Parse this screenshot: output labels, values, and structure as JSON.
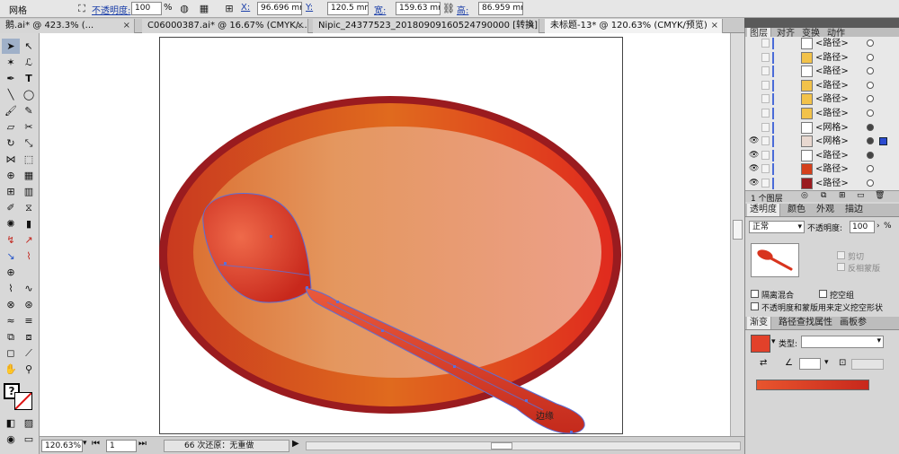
{
  "control_bar": {
    "mode_label": "网格",
    "opacity_label": "不透明度:",
    "opacity_value": "100",
    "percent": "%",
    "x_label": "X:",
    "x_value": "96.696 mm",
    "y_label": "Y:",
    "y_value": "120.5 mm",
    "width_label": "宽:",
    "width_value": "159.63 mm",
    "height_label": "高:",
    "height_value": "86.959 mm"
  },
  "tabs": [
    {
      "label": "鹅.ai* @ 423.3% (..."
    },
    {
      "label": "C06000387.ai* @ 16.67% (CMYK/..."
    },
    {
      "label": "Nipic_24377523_20180909160524790000 [转换].ai*"
    },
    {
      "label": "未标题-13* @ 120.63% (CMYK/预览)"
    }
  ],
  "canvas": {
    "annotation": "边缘",
    "colors": {
      "rim": "#9a1b1f",
      "plate_outer": "#d4401c",
      "plate_inner_left": "#e39a6a",
      "plate_inner_right": "#eda688",
      "spoon": "#e2412a",
      "path": "#5c6fd8"
    }
  },
  "status": {
    "zoom": "120.63%",
    "page": "1",
    "undo": "66 次还原：无重做"
  },
  "layers_panel": {
    "tabs": [
      "图层",
      "对齐",
      "变换",
      "动作"
    ],
    "items": [
      {
        "name": "<路径>",
        "visible": false,
        "thumb": "#ffffff",
        "target": false
      },
      {
        "name": "<路径>",
        "visible": false,
        "thumb": "#f2c24a",
        "target": false
      },
      {
        "name": "<路径>",
        "visible": false,
        "thumb": "#ffffff",
        "target": false
      },
      {
        "name": "<路径>",
        "visible": false,
        "thumb": "#f2c24a",
        "target": false
      },
      {
        "name": "<路径>",
        "visible": false,
        "thumb": "#f2c24a",
        "target": false
      },
      {
        "name": "<路径>",
        "visible": false,
        "thumb": "#f2c24a",
        "target": false
      },
      {
        "name": "<网格>",
        "visible": false,
        "thumb": "#ffffff",
        "target": true
      },
      {
        "name": "<网格>",
        "visible": true,
        "thumb": "#e8d8d0",
        "target": true
      },
      {
        "name": "<路径>",
        "visible": true,
        "thumb": "#ffffff",
        "target": true
      },
      {
        "name": "<路径>",
        "visible": true,
        "thumb": "#d4401c",
        "target": false
      },
      {
        "name": "<路径>",
        "visible": true,
        "thumb": "#9a1b1f",
        "target": false
      }
    ],
    "layer_count": "1 个图层"
  },
  "transparency_panel": {
    "tabs": [
      "透明度",
      "颜色",
      "外观",
      "描边"
    ],
    "blend_mode": "正常",
    "opacity_label": "不透明度:",
    "opacity_value": "100",
    "percent": "%",
    "clip_label": "剪切",
    "invert_mask_label": "反相蒙版",
    "isolate_label": "隔离混合",
    "knockout_label": "挖空组",
    "opacity_mask_label": "不透明度和蒙版用来定义挖空形状"
  },
  "gradient_panel": {
    "tabs": [
      "渐变",
      "路径查找",
      "属性",
      "画板参"
    ],
    "type_label": "类型:",
    "swatch_color": "#e2412a"
  }
}
